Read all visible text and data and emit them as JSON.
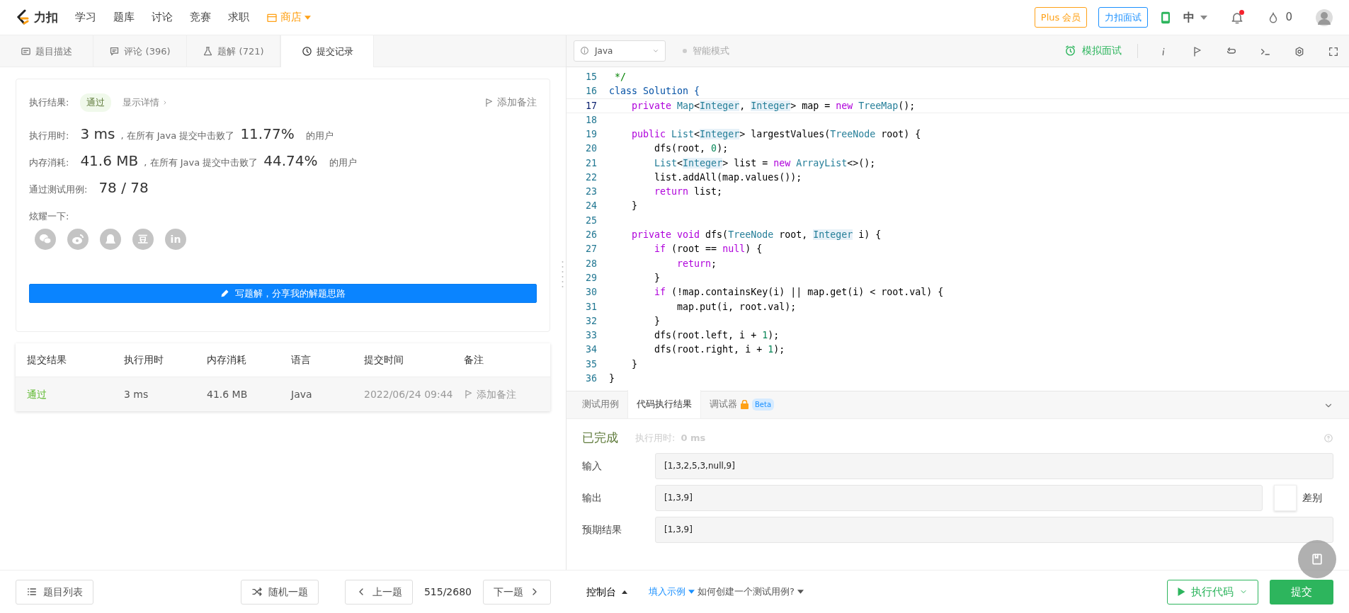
{
  "topnav": {
    "logo": "力扣",
    "links": [
      "学习",
      "题库",
      "讨论",
      "竞赛",
      "求职"
    ],
    "store": "商店",
    "plus": "Plus 会员",
    "interview": "力扣面试",
    "lang": "中",
    "notifications_unread": true,
    "flames": "0"
  },
  "left_tabs": [
    {
      "label": "题目描述",
      "selected": false
    },
    {
      "label": "评论 (396)",
      "selected": false
    },
    {
      "label": "题解 (721)",
      "selected": false
    },
    {
      "label": "提交记录",
      "selected": true
    }
  ],
  "result": {
    "status_label": "执行结果:",
    "status": "通过",
    "details": "显示详情",
    "add_note": "添加备注",
    "time_label": "执行用时:",
    "time": "3 ms",
    "time_text": ", 在所有 Java 提交中击败了",
    "time_pct": "11.77%",
    "time_suffix": "的用户",
    "mem_label": "内存消耗:",
    "mem": "41.6 MB",
    "mem_text": ", 在所有 Java 提交中击败了",
    "mem_pct": "44.74%",
    "mem_suffix": "的用户",
    "cases_label": "通过测试用例:",
    "cases": "78 / 78",
    "share_label": "炫耀一下:",
    "share": [
      {
        "kind": "chat"
      },
      {
        "kind": "weibo"
      },
      {
        "kind": "penguin"
      },
      {
        "kind": "text",
        "label": "豆"
      },
      {
        "kind": "text",
        "label": "in"
      }
    ],
    "write_button": "写题解，分享我的解题思路"
  },
  "submissions": {
    "columns": [
      "提交结果",
      "执行用时",
      "内存消耗",
      "语言",
      "提交时间",
      "备注"
    ],
    "rows": [
      {
        "status": "通过",
        "time": "3 ms",
        "memory": "41.6 MB",
        "language": "Java",
        "submitted": "2022/06/24 09:44",
        "note": "添加备注"
      }
    ]
  },
  "left_footer": {
    "list": "题目列表",
    "random": "随机一题",
    "prev": "上一题",
    "counter": "515/2680",
    "next": "下一题"
  },
  "editor_toolbar": {
    "language": "Java",
    "smart_mode": "智能模式",
    "smart_mode_on": false,
    "mock": "模拟面试"
  },
  "code": [
    {
      "n": "15",
      "current": false,
      "tokens": [
        {
          "kind": "comment",
          "text": " */"
        }
      ]
    },
    {
      "n": "16",
      "current": false,
      "tokens": [
        {
          "kind": "decl",
          "text": "class Solution {"
        }
      ]
    },
    {
      "n": "17",
      "current": true,
      "tokens": [
        {
          "kind": "kw",
          "text": "    private"
        },
        {
          "kind": "type",
          "text": " Map"
        },
        {
          "kind": "plain",
          "text": "<"
        },
        {
          "kind": "hl",
          "text": "Integer"
        },
        {
          "kind": "plain",
          "text": ", "
        },
        {
          "kind": "hl",
          "text": "Integer"
        },
        {
          "kind": "plain",
          "text": "> map = "
        },
        {
          "kind": "kw",
          "text": "new"
        },
        {
          "kind": "type",
          "text": " TreeMap"
        },
        {
          "kind": "plain",
          "text": "();"
        }
      ]
    },
    {
      "n": "18",
      "current": false
    },
    {
      "n": "19",
      "current": false,
      "tokens": [
        {
          "kind": "kw",
          "text": "    public"
        },
        {
          "kind": "type",
          "text": " List"
        },
        {
          "kind": "plain",
          "text": "<"
        },
        {
          "kind": "hl",
          "text": "Integer"
        },
        {
          "kind": "plain",
          "text": "> largestValues("
        },
        {
          "kind": "type",
          "text": "TreeNode"
        },
        {
          "kind": "plain",
          "text": " root) {"
        }
      ]
    },
    {
      "n": "20",
      "current": false,
      "tokens": [
        {
          "kind": "plain",
          "text": "        dfs(root, "
        },
        {
          "kind": "num",
          "text": "0"
        },
        {
          "kind": "plain",
          "text": ");"
        }
      ]
    },
    {
      "n": "21",
      "current": false,
      "tokens": [
        {
          "kind": "type",
          "text": "        List"
        },
        {
          "kind": "plain",
          "text": "<"
        },
        {
          "kind": "hl",
          "text": "Integer"
        },
        {
          "kind": "plain",
          "text": "> list = "
        },
        {
          "kind": "kw",
          "text": "new"
        },
        {
          "kind": "type",
          "text": " ArrayList"
        },
        {
          "kind": "plain",
          "text": "<>();"
        }
      ]
    },
    {
      "n": "22",
      "current": false,
      "tokens": [
        {
          "kind": "plain",
          "text": "        list.addAll(map.values());"
        }
      ]
    },
    {
      "n": "23",
      "current": false,
      "tokens": [
        {
          "kind": "kw",
          "text": "        return"
        },
        {
          "kind": "plain",
          "text": " list;"
        }
      ]
    },
    {
      "n": "24",
      "current": false,
      "tokens": [
        {
          "kind": "plain",
          "text": "    }"
        }
      ]
    },
    {
      "n": "25",
      "current": false
    },
    {
      "n": "26",
      "current": false,
      "tokens": [
        {
          "kind": "kw",
          "text": "    private"
        },
        {
          "kind": "kw",
          "text": " void"
        },
        {
          "kind": "plain",
          "text": " dfs("
        },
        {
          "kind": "type",
          "text": "TreeNode"
        },
        {
          "kind": "plain",
          "text": " root, "
        },
        {
          "kind": "hl",
          "text": "Integer"
        },
        {
          "kind": "plain",
          "text": " i) {"
        }
      ]
    },
    {
      "n": "27",
      "current": false,
      "tokens": [
        {
          "kind": "kw",
          "text": "        if"
        },
        {
          "kind": "plain",
          "text": " (root == "
        },
        {
          "kind": "kw",
          "text": "null"
        },
        {
          "kind": "plain",
          "text": ") {"
        }
      ]
    },
    {
      "n": "28",
      "current": false,
      "tokens": [
        {
          "kind": "kw",
          "text": "            return"
        },
        {
          "kind": "plain",
          "text": ";"
        }
      ]
    },
    {
      "n": "29",
      "current": false,
      "tokens": [
        {
          "kind": "plain",
          "text": "        }"
        }
      ]
    },
    {
      "n": "30",
      "current": false,
      "tokens": [
        {
          "kind": "kw",
          "text": "        if"
        },
        {
          "kind": "plain",
          "text": " (!map.containsKey(i) || map.get(i) < root.val) {"
        }
      ]
    },
    {
      "n": "31",
      "current": false,
      "tokens": [
        {
          "kind": "plain",
          "text": "            map.put(i, root.val);"
        }
      ]
    },
    {
      "n": "32",
      "current": false,
      "tokens": [
        {
          "kind": "plain",
          "text": "        }"
        }
      ]
    },
    {
      "n": "33",
      "current": false,
      "tokens": [
        {
          "kind": "plain",
          "text": "        dfs(root.left, i + "
        },
        {
          "kind": "num",
          "text": "1"
        },
        {
          "kind": "plain",
          "text": ");"
        }
      ]
    },
    {
      "n": "34",
      "current": false,
      "tokens": [
        {
          "kind": "plain",
          "text": "        dfs(root.right, i + "
        },
        {
          "kind": "num",
          "text": "1"
        },
        {
          "kind": "plain",
          "text": ");"
        }
      ]
    },
    {
      "n": "35",
      "current": false,
      "tokens": [
        {
          "kind": "plain",
          "text": "    }"
        }
      ]
    },
    {
      "n": "36",
      "current": false,
      "tokens": [
        {
          "kind": "plain",
          "text": "}"
        }
      ]
    }
  ],
  "console_tabs": [
    {
      "label": "测试用例",
      "selected": false,
      "locked": false
    },
    {
      "label": "代码执行结果",
      "selected": true,
      "locked": false
    },
    {
      "label": "调试器",
      "selected": false,
      "locked": true,
      "badge": "Beta"
    }
  ],
  "run_result": {
    "status": "已完成",
    "time_label": "执行用时:",
    "time": "0 ms",
    "fields": [
      {
        "label": "输入",
        "value": "[1,3,2,5,3,null,9]"
      },
      {
        "label": "输出",
        "value": "[1,3,9]",
        "diff": "差别",
        "diff_on": false
      },
      {
        "label": "预期结果",
        "value": "[1,3,9]"
      }
    ]
  },
  "right_footer": {
    "console": "控制台",
    "fill_example": "填入示例",
    "how_to": "如何创建一个测试用例?",
    "run": "执行代码",
    "submit": "提交"
  }
}
